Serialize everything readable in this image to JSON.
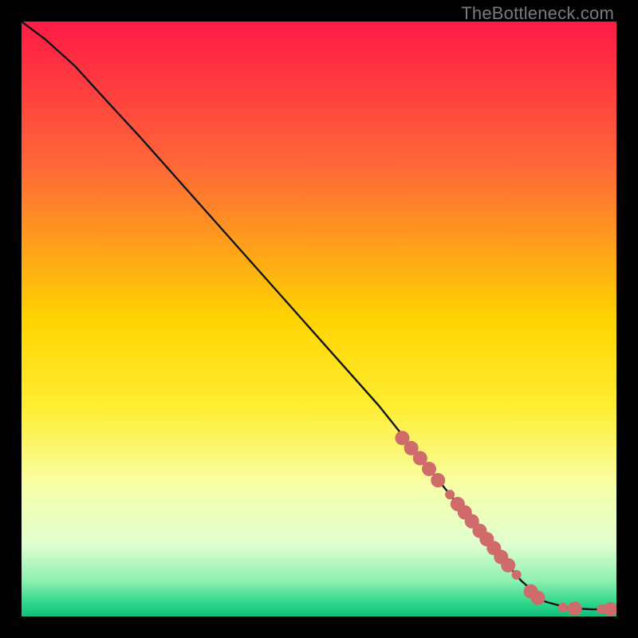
{
  "watermark": "TheBottleneck.com",
  "chart_data": {
    "type": "line",
    "title": "",
    "xlabel": "",
    "ylabel": "",
    "xlim": [
      0,
      100
    ],
    "ylim": [
      0,
      100
    ],
    "gradient_stops": [
      {
        "offset": 0,
        "color": "#ff1a46"
      },
      {
        "offset": 25,
        "color": "#ff6a36"
      },
      {
        "offset": 50,
        "color": "#ffd400"
      },
      {
        "offset": 65,
        "color": "#ffee33"
      },
      {
        "offset": 78,
        "color": "#f8ffa8"
      },
      {
        "offset": 88,
        "color": "#e0ffd0"
      },
      {
        "offset": 94,
        "color": "#8cf0b0"
      },
      {
        "offset": 98,
        "color": "#29d58a"
      },
      {
        "offset": 100,
        "color": "#0fbf78"
      }
    ],
    "series": [
      {
        "name": "bottleneck-curve",
        "stroke": "#111111",
        "points": [
          {
            "x": 0,
            "y": 100
          },
          {
            "x": 4,
            "y": 97
          },
          {
            "x": 9,
            "y": 92.5
          },
          {
            "x": 14,
            "y": 87
          },
          {
            "x": 20,
            "y": 80.5
          },
          {
            "x": 28,
            "y": 71.5
          },
          {
            "x": 36,
            "y": 62.5
          },
          {
            "x": 44,
            "y": 53.5
          },
          {
            "x": 52,
            "y": 44.5
          },
          {
            "x": 60,
            "y": 35.5
          },
          {
            "x": 66,
            "y": 28
          },
          {
            "x": 72,
            "y": 20.5
          },
          {
            "x": 78,
            "y": 13
          },
          {
            "x": 84,
            "y": 6
          },
          {
            "x": 88,
            "y": 2.5
          },
          {
            "x": 92,
            "y": 1.4
          },
          {
            "x": 96,
            "y": 1.2
          },
          {
            "x": 100,
            "y": 1.2
          }
        ]
      }
    ],
    "markers": {
      "name": "highlight-dots",
      "color": "#cf6b6b",
      "radius_large": 9,
      "radius_small": 6,
      "points": [
        {
          "x": 64.0,
          "y": 30.0,
          "r": "large"
        },
        {
          "x": 65.5,
          "y": 28.3,
          "r": "large"
        },
        {
          "x": 67.0,
          "y": 26.6,
          "r": "large"
        },
        {
          "x": 68.5,
          "y": 24.8,
          "r": "large"
        },
        {
          "x": 70.0,
          "y": 22.9,
          "r": "large"
        },
        {
          "x": 72.0,
          "y": 20.5,
          "r": "small"
        },
        {
          "x": 73.3,
          "y": 18.9,
          "r": "large"
        },
        {
          "x": 74.5,
          "y": 17.5,
          "r": "large"
        },
        {
          "x": 75.7,
          "y": 16.0,
          "r": "large"
        },
        {
          "x": 77.0,
          "y": 14.4,
          "r": "large"
        },
        {
          "x": 78.2,
          "y": 13.0,
          "r": "large"
        },
        {
          "x": 79.4,
          "y": 11.5,
          "r": "large"
        },
        {
          "x": 80.6,
          "y": 10.0,
          "r": "large"
        },
        {
          "x": 81.8,
          "y": 8.6,
          "r": "large"
        },
        {
          "x": 83.2,
          "y": 7.0,
          "r": "small"
        },
        {
          "x": 85.6,
          "y": 4.2,
          "r": "large"
        },
        {
          "x": 86.8,
          "y": 3.1,
          "r": "large"
        },
        {
          "x": 91.0,
          "y": 1.5,
          "r": "small"
        },
        {
          "x": 93.0,
          "y": 1.3,
          "r": "large"
        },
        {
          "x": 97.5,
          "y": 1.2,
          "r": "small"
        },
        {
          "x": 99.0,
          "y": 1.2,
          "r": "large"
        }
      ]
    }
  }
}
